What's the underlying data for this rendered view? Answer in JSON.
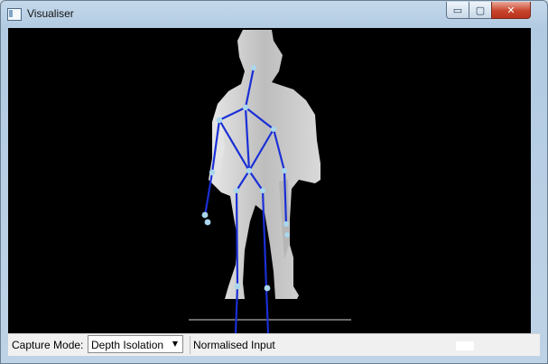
{
  "window": {
    "title": "Visualiser"
  },
  "titlebar_controls": {
    "minimize": "▭",
    "maximize": "▢",
    "close": "✕"
  },
  "status_bar": {
    "capture_mode_label": "Capture Mode:",
    "capture_mode_value": "Depth Isolation",
    "dropdown_icon": "▼",
    "status_text": "Normalised Input"
  },
  "colors": {
    "viewport_background": "#000000",
    "skeleton_bone": "#1a2fd6",
    "skeleton_joint": "#a9d7ee",
    "depth_silhouette": "#cfcfcf"
  },
  "icons": [
    "app-icon",
    "minimize-icon",
    "maximize-icon",
    "close-icon",
    "dropdown-arrow-icon"
  ]
}
